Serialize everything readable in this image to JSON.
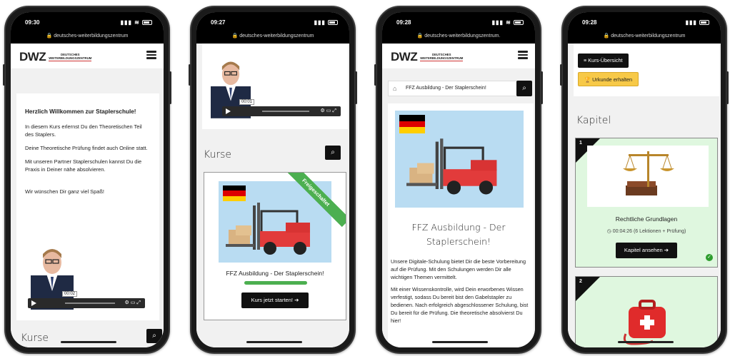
{
  "phones": [
    {
      "time": "09:30",
      "url": "deutsches-weiterbildungszentrum",
      "logo": {
        "big": "DWZ",
        "line1": "DEUTSCHES",
        "line2": "WEITERBILDUNGSZENTRUM"
      },
      "welcome": {
        "heading": "Herzlich Willkommen zur Staplerschule!",
        "p1": "In diesem Kurs erlernst Du den Theoretischen Teil des Staplers.",
        "p2": "Deine Theoretische Prüfung findet auch Online statt.",
        "p3": "Mit unseren Partner Staplerschulen kannst Du die Praxis in Deiner nähe absolvieren.",
        "p4": "Wir wünschen Dir ganz viel Spaß!"
      },
      "video_time": "00:02",
      "section_title": "Kurse"
    },
    {
      "time": "09:27",
      "url": "deutsches-weiterbildungszentrum",
      "video_time": "00:01",
      "section_title": "Kurse",
      "ribbon": "Freigeschaltet",
      "course_name": "FFZ Ausbildung - Der Staplerschein!",
      "progress_fraction": 1.0,
      "start_button": "Kurs jetzt starten!"
    },
    {
      "time": "09:28",
      "url": "deutsches-weiterbildungszentrum.",
      "logo": {
        "big": "DWZ",
        "line1": "DEUTSCHES",
        "line2": "WEITERBILDUNGSZENTRUM"
      },
      "breadcrumb": "FFZ Ausbildung - Der Staplerschein!",
      "title_line1": "FFZ Ausbildung - Der",
      "title_line2": "Staplerschein!",
      "desc1": "Unsere Digitale-Schulung bietet Dir die beste Vorbereitung auf die Prüfung. Mit den Schulungen werden Dir alle wichtigen Themen vermittelt.",
      "desc2": "Mit einer Wissenskontrolle, wird Dein erworbenes Wissen verfestigt, sodass Du bereit bist den Gabelstapler zu bedienen. Nach erfolgreich abgeschlossener Schulung, bist Du bereit für die Prüfung. Die theoretische absolvierst Du hier!"
    },
    {
      "time": "09:28",
      "url": "deutsches-weiterbildungszentrum",
      "btn_overview": "Kurs-Übersicht",
      "btn_certificate": "Urkunde erhalten",
      "section_title": "Kapitel",
      "chapters": [
        {
          "num": "1",
          "title": "Rechtliche Grundlagen",
          "duration": "00:04:26 (6 Lektionen + Prüfung)",
          "button": "Kapitel ansehen"
        },
        {
          "num": "2"
        }
      ]
    }
  ],
  "colors": {
    "accent_green": "#4caf50",
    "chapter_bg": "#dff7df",
    "certificate_yellow": "#f7c948",
    "course_img_bg": "#b9dcf2"
  }
}
